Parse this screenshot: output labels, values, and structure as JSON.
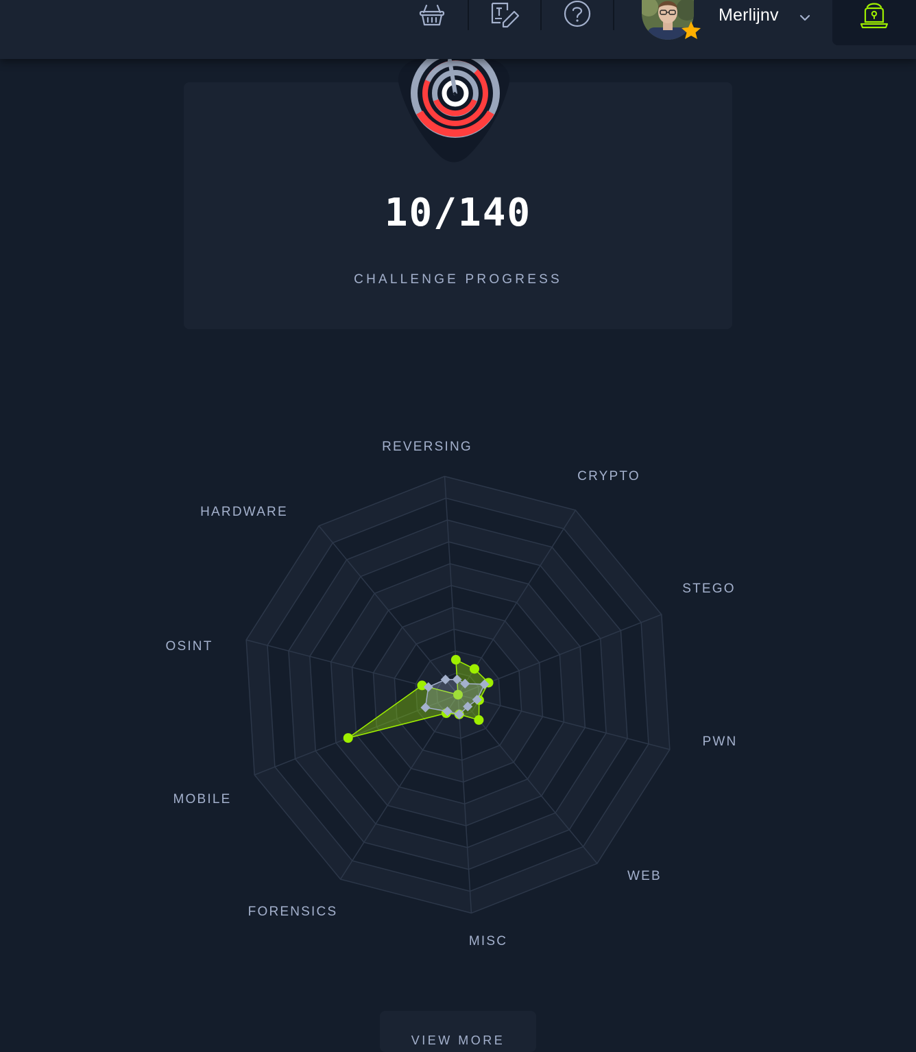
{
  "header": {
    "nav_icons": [
      "basket-icon",
      "writeup-edit-icon",
      "help-icon"
    ],
    "username": "Merlijnv",
    "vpn_icon": "vpn-laptop-icon",
    "accent_color": "#9fef00",
    "star_color": "#ffaf00"
  },
  "progress": {
    "value": "10/140",
    "label": "CHALLENGE PROGRESS",
    "badge_icon": "challenges-target-icon"
  },
  "chart_data": {
    "type": "radar",
    "categories": [
      "REVERSING",
      "CRYPTO",
      "STEGO",
      "PWN",
      "WEB",
      "MISC",
      "FORENSICS",
      "MOBILE",
      "OSINT",
      "HARDWARE"
    ],
    "rmax": 100,
    "rings": 10,
    "series": [
      {
        "values": [
          16,
          14,
          15,
          10,
          15,
          9,
          10,
          54,
          17,
          0
        ],
        "color": "#9fef00",
        "fill": "rgba(159,239,0,0.35)"
      },
      {
        "values": [
          7,
          6,
          13,
          9,
          7,
          9,
          9,
          16,
          14,
          9
        ],
        "color": "#a4b1cd",
        "fill": "rgba(164,177,205,0.28)"
      }
    ]
  },
  "actions": {
    "view_more": "VIEW MORE"
  }
}
